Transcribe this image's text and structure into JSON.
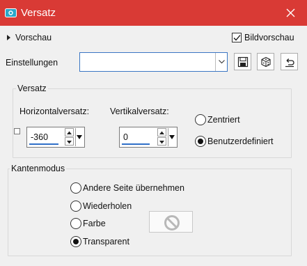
{
  "window": {
    "title": "Versatz",
    "accent_color": "#d93a35",
    "icon": "camera-icon"
  },
  "header": {
    "preview_label": "Vorschau",
    "live_preview_label": "Bildvorschau",
    "live_preview_checked": true
  },
  "settings": {
    "label": "Einstellungen",
    "value": "",
    "buttons": [
      "save-icon",
      "randomize-dice-icon",
      "reset-icon"
    ]
  },
  "offset_group": {
    "title": "Versatz",
    "horizontal_label": "Horizontalversatz:",
    "horizontal_value": "-360",
    "vertical_label": "Vertikalversatz:",
    "vertical_value": "0",
    "options": [
      {
        "label": "Zentriert",
        "selected": false
      },
      {
        "label": "Benutzerdefiniert",
        "selected": true
      }
    ]
  },
  "edge_group": {
    "title": "Kantenmodus",
    "options": [
      {
        "label": "Andere Seite übernehmen",
        "selected": false
      },
      {
        "label": "Wiederholen",
        "selected": false
      },
      {
        "label": "Farbe",
        "selected": false
      },
      {
        "label": "Transparent",
        "selected": true
      }
    ],
    "color_swatch_icon": "disabled-icon"
  }
}
